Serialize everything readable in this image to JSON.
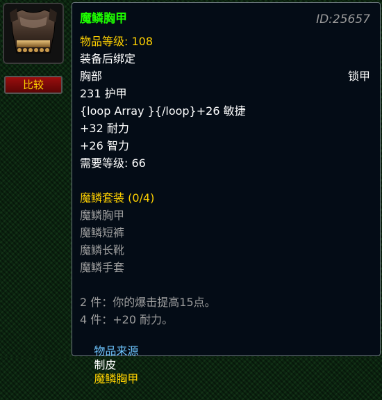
{
  "item": {
    "name": "魔鳞胸甲",
    "id_text": "ID:25657",
    "item_level_label": "物品等级: 108",
    "bind": "装备后绑定",
    "slot": "胸部",
    "armor_type": "锁甲",
    "armor": "231 护甲",
    "stats": [
      "{loop Array }{/loop}+26 敏捷",
      "+32 耐力",
      "+26 智力"
    ],
    "required_level": "需要等级: 66",
    "set": {
      "title": "魔鳞套装 (0/4)",
      "pieces": [
        "魔鳞胸甲",
        "魔鳞短裤",
        "魔鳞长靴",
        "魔鳞手套"
      ],
      "bonuses": [
        "2 件：你的爆击提高15点。",
        "4 件：+20 耐力。"
      ]
    },
    "source": {
      "label": "物品来源",
      "profession": "制皮",
      "recipe": "魔鳞胸甲"
    }
  },
  "compare_button": "比较",
  "icon": "chest-armor-icon",
  "colors": {
    "name": "#1eff00",
    "yellow": "#ffd100",
    "gray": "#9d9d9d",
    "source_blue": "#6ec6ff"
  }
}
